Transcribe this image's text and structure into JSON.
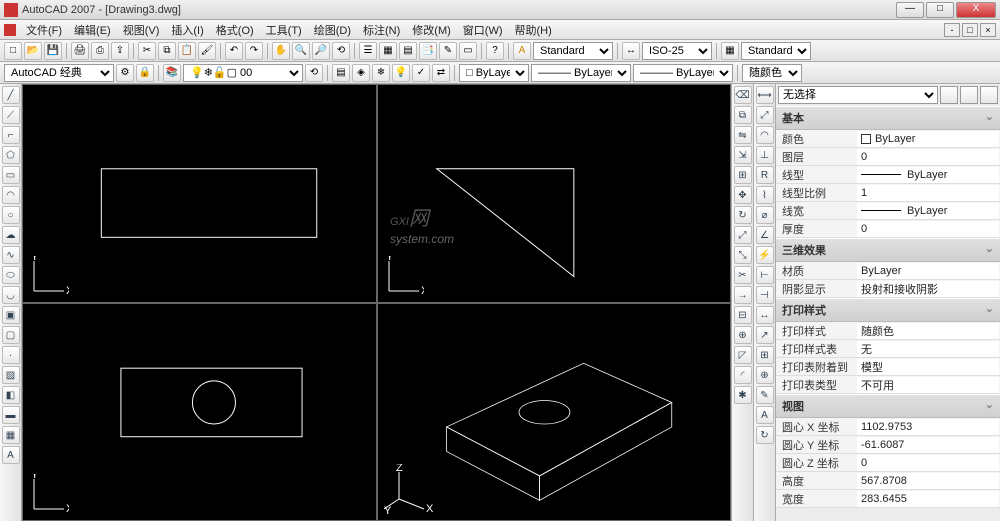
{
  "title": "AutoCAD 2007 - [Drawing3.dwg]",
  "menus": [
    "文件(F)",
    "编辑(E)",
    "视图(V)",
    "插入(I)",
    "格式(O)",
    "工具(T)",
    "绘图(D)",
    "标注(N)",
    "修改(M)",
    "窗口(W)",
    "帮助(H)"
  ],
  "workspace": "AutoCAD 经典",
  "layer_current": "0",
  "linetype1": "ByLayer",
  "linetype2": "ByLayer",
  "linetype3": "ByLayer",
  "text_style": "Standard",
  "dim_style": "ISO-25",
  "table_style": "Standard",
  "color_control": "随颜色",
  "properties": {
    "selection": "无选择",
    "sections": [
      {
        "title": "基本",
        "rows": [
          {
            "label": "颜色",
            "value": "ByLayer",
            "square": true
          },
          {
            "label": "图层",
            "value": "0"
          },
          {
            "label": "线型",
            "value": "ByLayer",
            "line": true
          },
          {
            "label": "线型比例",
            "value": "1"
          },
          {
            "label": "线宽",
            "value": "ByLayer",
            "line": true
          },
          {
            "label": "厚度",
            "value": "0"
          }
        ]
      },
      {
        "title": "三维效果",
        "rows": [
          {
            "label": "材质",
            "value": "ByLayer"
          },
          {
            "label": "阴影显示",
            "value": "投射和接收阴影"
          }
        ]
      },
      {
        "title": "打印样式",
        "rows": [
          {
            "label": "打印样式",
            "value": "随颜色"
          },
          {
            "label": "打印样式表",
            "value": "无"
          },
          {
            "label": "打印表附着到",
            "value": "模型"
          },
          {
            "label": "打印表类型",
            "value": "不可用"
          }
        ]
      },
      {
        "title": "视图",
        "rows": [
          {
            "label": "圆心 X 坐标",
            "value": "1102.9753"
          },
          {
            "label": "圆心 Y 坐标",
            "value": "-61.6087"
          },
          {
            "label": "圆心 Z 坐标",
            "value": "0"
          },
          {
            "label": "高度",
            "value": "567.8708"
          },
          {
            "label": "宽度",
            "value": "283.6455"
          }
        ]
      }
    ]
  },
  "watermark": {
    "big": "GXI",
    "net": "网",
    "sub": "system.com"
  },
  "axes": {
    "x": "X",
    "y": "Y",
    "z": "Z"
  }
}
